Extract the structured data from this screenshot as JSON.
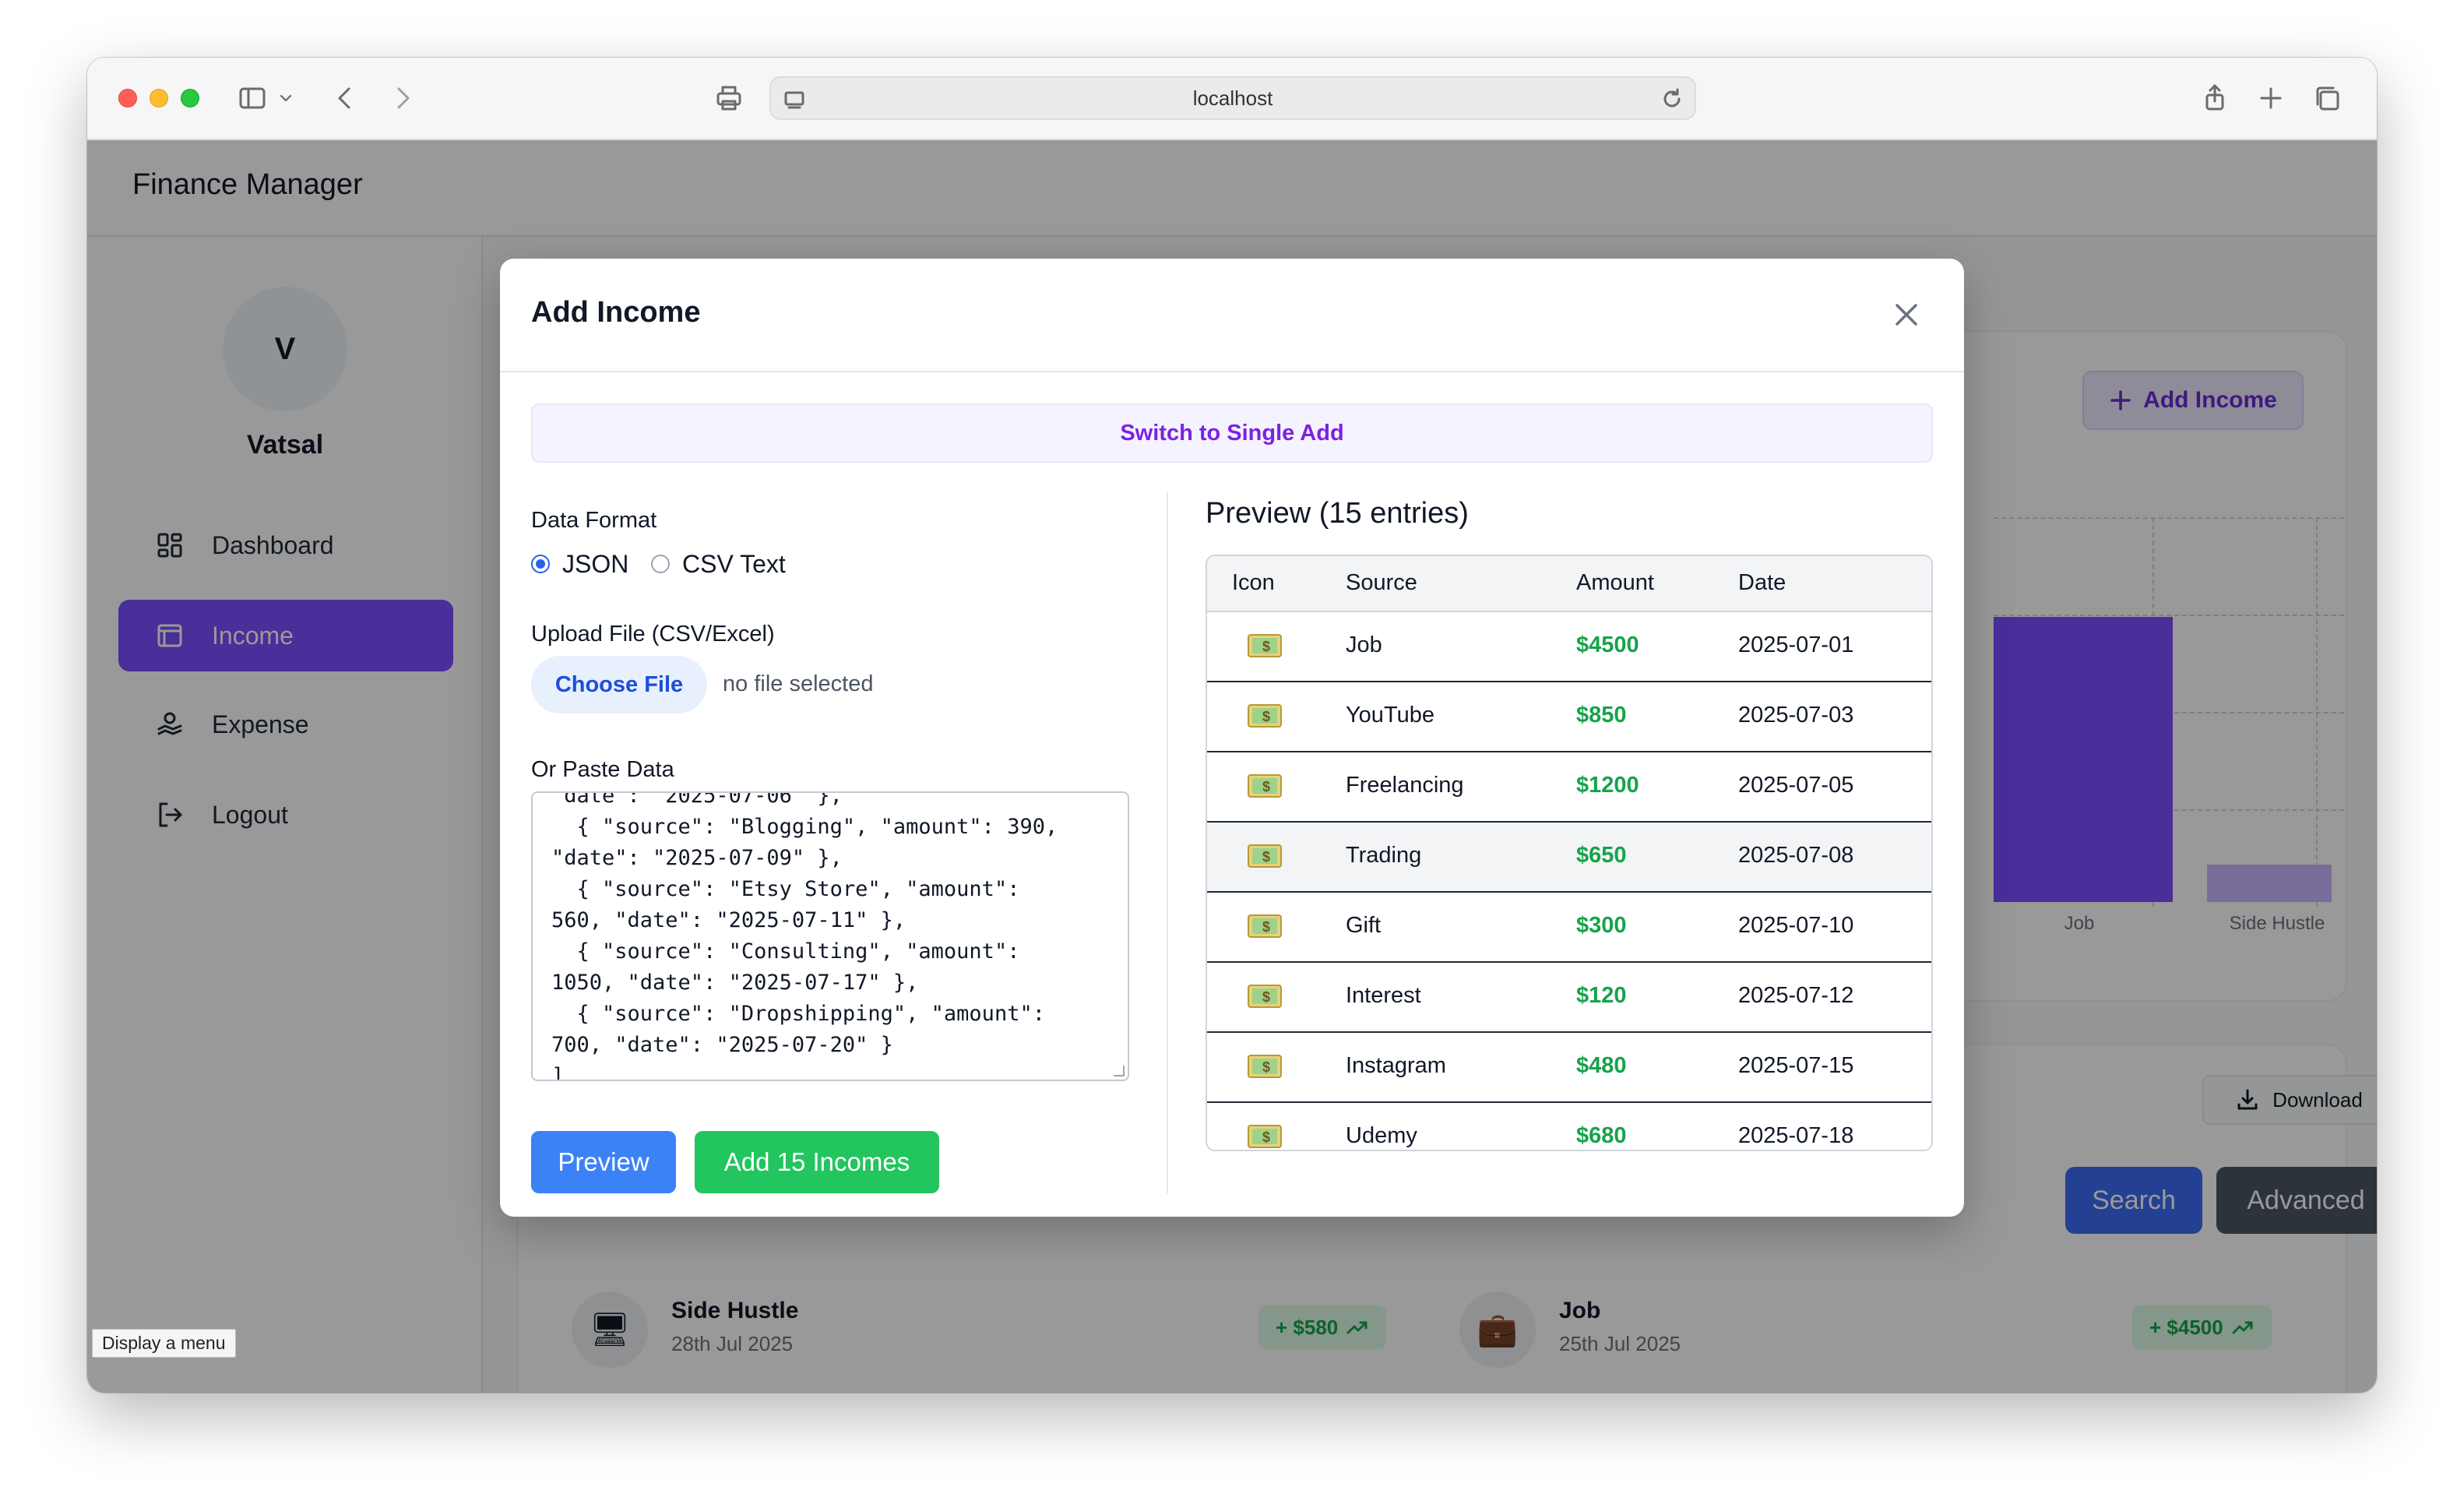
{
  "browser": {
    "url": "localhost"
  },
  "app": {
    "title": "Finance Manager",
    "user": {
      "initial": "V",
      "name": "Vatsal"
    },
    "nav": [
      {
        "label": "Dashboard",
        "icon": "dashboard-icon",
        "active": false
      },
      {
        "label": "Income",
        "icon": "income-icon",
        "active": true
      },
      {
        "label": "Expense",
        "icon": "expense-icon",
        "active": false
      },
      {
        "label": "Logout",
        "icon": "logout-icon",
        "active": false
      }
    ]
  },
  "background": {
    "add_income_label": "Add Income",
    "chart_labels": [
      "Job",
      "Side Hustle"
    ],
    "download_label": "Download",
    "search_label": "Search",
    "advanced_label": "Advanced",
    "transactions": [
      {
        "name": "Side Hustle",
        "date": "28th Jul 2025",
        "amount": "+ $580",
        "icon": "desktop-computer-icon"
      },
      {
        "name": "Job",
        "date": "25th Jul 2025",
        "amount": "+ $4500",
        "icon": "briefcase-icon"
      }
    ]
  },
  "tooltip": "Display a menu",
  "modal": {
    "title": "Add Income",
    "switch_label": "Switch to Single Add",
    "data_format_label": "Data Format",
    "format_options": [
      {
        "label": "JSON",
        "checked": true
      },
      {
        "label": "CSV Text",
        "checked": false
      }
    ],
    "upload_label": "Upload File (CSV/Excel)",
    "choose_file_label": "Choose File",
    "no_file_text": "no file selected",
    "paste_label": "Or Paste Data",
    "paste_text": "\"date\": \"2025-07-06\" },\n  { \"source\": \"Blogging\", \"amount\": 390,\n\"date\": \"2025-07-09\" },\n  { \"source\": \"Etsy Store\", \"amount\":\n560, \"date\": \"2025-07-11\" },\n  { \"source\": \"Consulting\", \"amount\":\n1050, \"date\": \"2025-07-17\" },\n  { \"source\": \"Dropshipping\", \"amount\":\n700, \"date\": \"2025-07-20\" }\n]",
    "preview_button": "Preview",
    "add_button": "Add 15 Incomes",
    "preview_title": "Preview (15 entries)",
    "columns": [
      "Icon",
      "Source",
      "Amount",
      "Date"
    ],
    "rows": [
      {
        "source": "Job",
        "amount": "$4500",
        "date": "2025-07-01"
      },
      {
        "source": "YouTube",
        "amount": "$850",
        "date": "2025-07-03"
      },
      {
        "source": "Freelancing",
        "amount": "$1200",
        "date": "2025-07-05"
      },
      {
        "source": "Trading",
        "amount": "$650",
        "date": "2025-07-08"
      },
      {
        "source": "Gift",
        "amount": "$300",
        "date": "2025-07-10"
      },
      {
        "source": "Interest",
        "amount": "$120",
        "date": "2025-07-12"
      },
      {
        "source": "Instagram",
        "amount": "$480",
        "date": "2025-07-15"
      },
      {
        "source": "Udemy",
        "amount": "$680",
        "date": "2025-07-18"
      }
    ]
  },
  "colors": {
    "accent": "#7c4dff",
    "primary_button": "#3b82f6",
    "success_button": "#22c55e",
    "amount_green": "#16a34a"
  }
}
